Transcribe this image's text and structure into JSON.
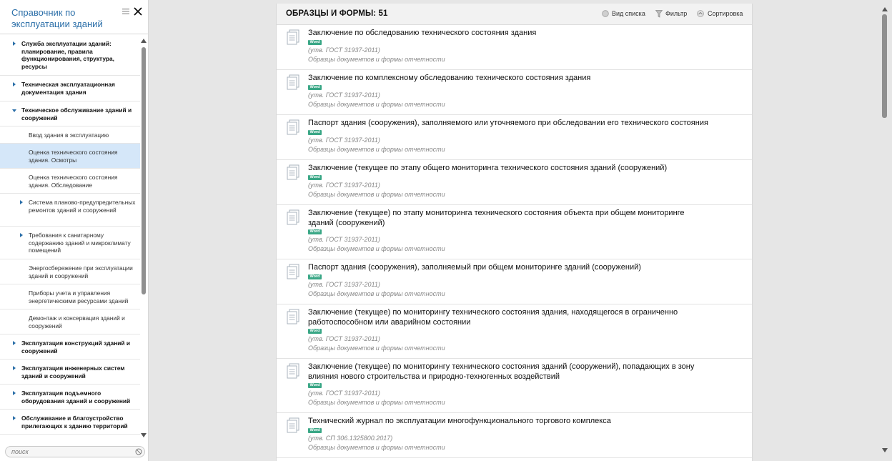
{
  "sidebar": {
    "title": "Справочник по эксплуатации зданий",
    "search_placeholder": "поиск",
    "items": [
      {
        "level": 1,
        "label": "Служба эксплуатации зданий: планирование, правила функционирования, структура, ресурсы",
        "arrow": "right"
      },
      {
        "level": 1,
        "label": "Техническая эксплуатационная документация здания",
        "arrow": "right"
      },
      {
        "level": 1,
        "label": "Техническое обслуживание зданий и сооружений",
        "arrow": "down"
      },
      {
        "level": 2,
        "label": "Ввод здания в эксплуатацию",
        "arrow": ""
      },
      {
        "level": 2,
        "label": "Оценка технического состояния здания. Осмотры",
        "arrow": "",
        "selected": true
      },
      {
        "level": 2,
        "label": "Оценка технического состояния здания. Обследование",
        "arrow": ""
      },
      {
        "level": 2,
        "label": "Система планово-предупредительных ремонтов зданий и сооружений",
        "arrow": "right"
      },
      {
        "level": 2,
        "label": "Требования к санитарному содержанию зданий и микроклимату помещений",
        "arrow": "right"
      },
      {
        "level": 2,
        "label": "Энергосбережение при эксплуатации зданий и сооружений",
        "arrow": ""
      },
      {
        "level": 2,
        "label": "Приборы учета и управления энергетическими ресурсами зданий",
        "arrow": ""
      },
      {
        "level": 2,
        "label": "Демонтаж и консервация зданий и сооружений",
        "arrow": ""
      },
      {
        "level": 1,
        "label": "Эксплуатация конструкций зданий и сооружений",
        "arrow": "right"
      },
      {
        "level": 1,
        "label": "Эксплуатация инженерных систем зданий и сооружений",
        "arrow": "right"
      },
      {
        "level": 1,
        "label": "Эксплуатация подъемного оборудования зданий и сооружений",
        "arrow": "right"
      },
      {
        "level": 1,
        "label": "Обслуживание и благоустройство прилегающих к зданию территорий",
        "arrow": "right"
      }
    ]
  },
  "main": {
    "title": "ОБРАЗЦЫ И ФОРМЫ: 51",
    "toolbar": {
      "view_label": "Вид списка",
      "filter_label": "Фильтр",
      "sort_label": "Сортировка"
    },
    "documents": [
      {
        "title": "Заключение по обследованию технического состояния здания",
        "badge": "Word",
        "note": "(утв. ГОСТ 31937-2011)",
        "source": "Образцы документов и формы отчетности"
      },
      {
        "title": "Заключение по комплексному обследованию технического состояния здания",
        "badge": "Word",
        "note": "(утв. ГОСТ 31937-2011)",
        "source": "Образцы документов и формы отчетности"
      },
      {
        "title": "Паспорт здания (сооружения), заполняемого или уточняемого при обследовании его технического состояния",
        "badge": "Word",
        "note": "(утв. ГОСТ 31937-2011)",
        "source": "Образцы документов и формы отчетности"
      },
      {
        "title": "Заключение (текущее по этапу общего мониторинга технического состояния зданий (сооружений)",
        "badge": "Word",
        "note": "(утв. ГОСТ 31937-2011)",
        "source": "Образцы документов и формы отчетности"
      },
      {
        "title": "Заключение (текущее) по этапу мониторинга технического состояния объекта при общем мониторинге зданий (сооружений)",
        "badge": "Word",
        "note": "(утв. ГОСТ 31937-2011)",
        "source": "Образцы документов и формы отчетности"
      },
      {
        "title": "Паспорт здания (сооружения), заполняемый при общем мониторинге зданий (сооружений)",
        "badge": "Word",
        "note": "(утв. ГОСТ 31937-2011)",
        "source": "Образцы документов и формы отчетности"
      },
      {
        "title": "Заключение (текущее) по мониторингу технического состояния здания, находящегося в ограниченно работоспособном или аварийном состоянии",
        "badge": "Word",
        "note": "(утв. ГОСТ 31937-2011)",
        "source": "Образцы документов и формы отчетности"
      },
      {
        "title": "Заключение (текущее) по мониторингу технического состояния зданий (сооружений), попадающих в зону влияния нового строительства и природно-техногенных воздействий",
        "badge": "Word",
        "note": "(утв. ГОСТ 31937-2011)",
        "source": "Образцы документов и формы отчетности"
      },
      {
        "title": "Технический журнал по эксплуатации многофункционального торгового комплекса",
        "badge": "Word",
        "note": "(утв. СП 306.1325800.2017)",
        "source": "Образцы документов и формы отчетности"
      }
    ]
  },
  "colors": {
    "accent": "#2a6ea8",
    "selected_bg": "#d5e7f9",
    "word_badge": "#3aa786"
  }
}
